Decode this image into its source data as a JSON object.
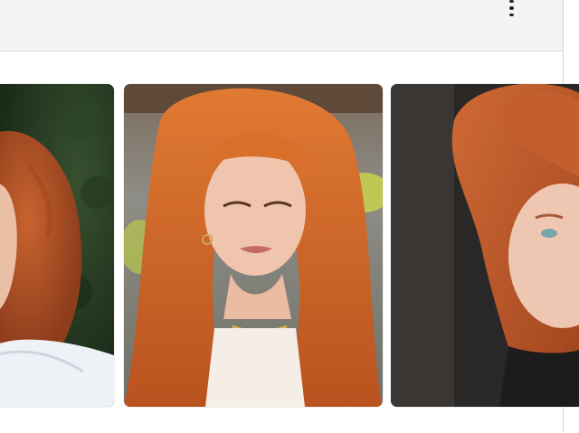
{
  "header": {
    "more_options_icon": "vertical-dots-icon"
  },
  "results": {
    "images": [
      {
        "alt": "",
        "hair_color": "#b8542a",
        "background": "#22361f"
      },
      {
        "alt": "",
        "hair_color": "#d9742f",
        "background": "#7d7f7d"
      },
      {
        "alt": "",
        "hair_color": "#c2572c",
        "background": "#242424"
      }
    ]
  }
}
